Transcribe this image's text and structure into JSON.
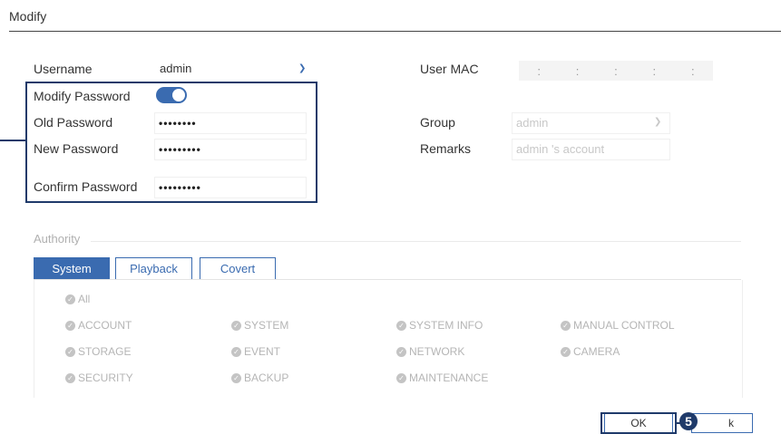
{
  "dialog": {
    "title": "Modify"
  },
  "user": {
    "username_label": "Username",
    "username_value": "admin",
    "modify_password_label": "Modify Password",
    "modify_password_on": true,
    "old_password_label": "Old Password",
    "old_password_value": "••••••••",
    "new_password_label": "New Password",
    "new_password_value": "•••••••••",
    "confirm_password_label": "Confirm Password",
    "confirm_password_value": "•••••••••"
  },
  "right": {
    "mac_label": "User MAC",
    "mac_separators": [
      ":",
      ":",
      ":",
      ":",
      ":"
    ],
    "group_label": "Group",
    "group_value": "admin",
    "remarks_label": "Remarks",
    "remarks_value": "admin 's account"
  },
  "authority": {
    "title": "Authority",
    "tabs": [
      "System",
      "Playback",
      "Covert"
    ],
    "active_tab": "System",
    "all_label": "All",
    "items": [
      "ACCOUNT",
      "SYSTEM",
      "SYSTEM INFO",
      "MANUAL CONTROL",
      "STORAGE",
      "EVENT",
      "NETWORK",
      "CAMERA",
      "SECURITY",
      "BACKUP",
      "MAINTENANCE"
    ]
  },
  "footer": {
    "ok_label": "OK",
    "back_label": "k",
    "step_number": "5"
  },
  "colors": {
    "accent": "#3a6bb0",
    "callout": "#1f3a6a",
    "disabled": "#b5b5b5"
  }
}
